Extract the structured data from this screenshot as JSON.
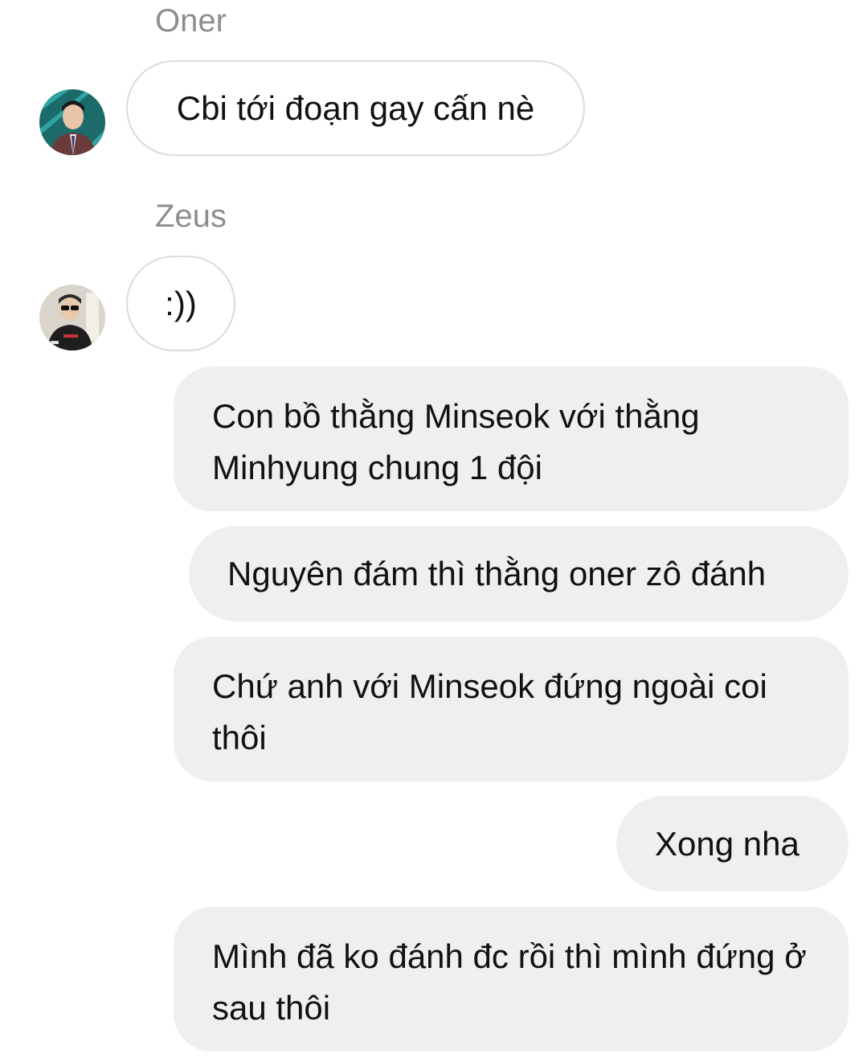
{
  "thread": {
    "groups": [
      {
        "sender": "Oner",
        "avatar_icon": "user-avatar-icon",
        "messages": [
          "Cbi tới đoạn gay cấn nè"
        ]
      },
      {
        "sender": "Zeus",
        "avatar_icon": "user-avatar-icon",
        "messages": [
          ":))"
        ]
      }
    ],
    "outgoing": [
      "Con bồ thằng Minseok với thằng Minhyung chung 1 đội",
      "Nguyên đám thì thằng oner zô đánh",
      "Chứ anh với Minseok đứng ngoài coi thôi",
      "Xong nha",
      "Mình đã ko đánh đc rồi thì mình đứng ở sau thôi"
    ]
  },
  "colors": {
    "incoming_bubble_border": "#dbdbdb",
    "outgoing_bubble_bg": "#efefef",
    "sender_name": "#8e8e8e",
    "text": "#111111"
  }
}
